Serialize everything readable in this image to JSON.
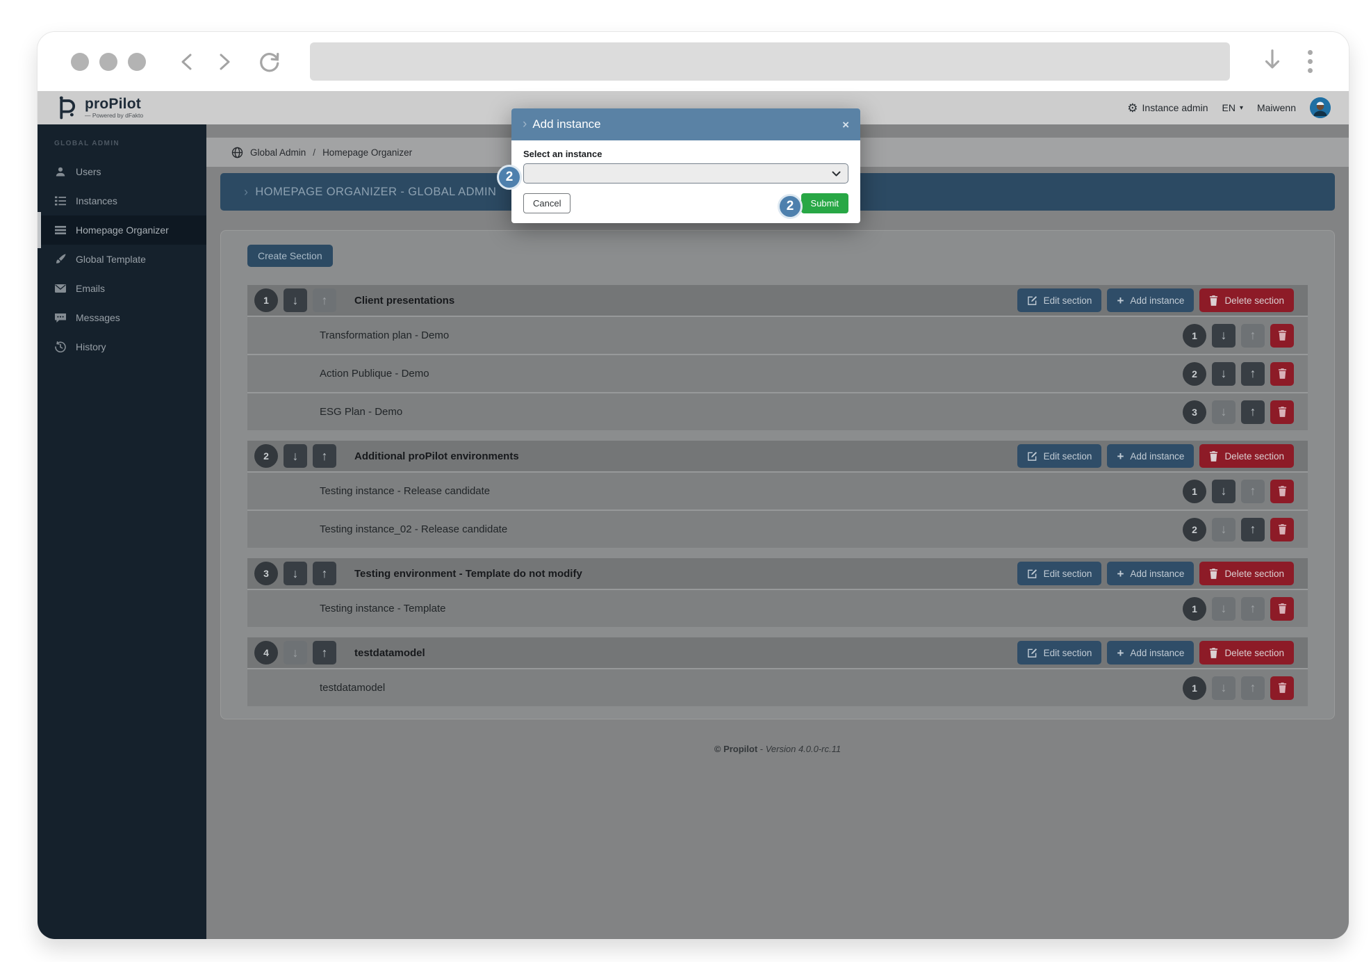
{
  "browser": {
    "url_value": ""
  },
  "header": {
    "brand": "proPilot",
    "tagline": "—  Powered by dFakto",
    "menu": {
      "instance_admin": "Instance admin",
      "language": "EN",
      "user_name": "Maiwenn"
    }
  },
  "sidebar": {
    "group_label": "GLOBAL ADMIN",
    "items": [
      {
        "label": "Users"
      },
      {
        "label": "Instances"
      },
      {
        "label": "Homepage Organizer"
      },
      {
        "label": "Global Template"
      },
      {
        "label": "Emails"
      },
      {
        "label": "Messages"
      },
      {
        "label": "History"
      }
    ]
  },
  "breadcrumb": {
    "items": [
      "Global Admin",
      "Homepage Organizer"
    ],
    "separator": "/"
  },
  "page": {
    "banner_title": "HOMEPAGE ORGANIZER - GLOBAL ADMIN",
    "create_section_label": "Create Section"
  },
  "section_buttons": {
    "edit": "Edit section",
    "add": "Add instance",
    "delete": "Delete section"
  },
  "sections": [
    {
      "num": "1",
      "title": "Client presentations",
      "can_move_down": true,
      "can_move_up": false,
      "rows": [
        {
          "num": "1",
          "name": "Transformation plan - Demo",
          "can_move_down": true,
          "can_move_up": false
        },
        {
          "num": "2",
          "name": "Action Publique - Demo",
          "can_move_down": true,
          "can_move_up": true
        },
        {
          "num": "3",
          "name": "ESG Plan - Demo",
          "can_move_down": false,
          "can_move_up": true
        }
      ]
    },
    {
      "num": "2",
      "title": "Additional proPilot environments",
      "can_move_down": true,
      "can_move_up": true,
      "rows": [
        {
          "num": "1",
          "name": "Testing instance - Release candidate",
          "can_move_down": true,
          "can_move_up": false
        },
        {
          "num": "2",
          "name": "Testing instance_02 - Release candidate",
          "can_move_down": false,
          "can_move_up": true
        }
      ]
    },
    {
      "num": "3",
      "title": "Testing environment - Template do not modify",
      "can_move_down": true,
      "can_move_up": true,
      "rows": [
        {
          "num": "1",
          "name": "Testing instance - Template",
          "can_move_down": false,
          "can_move_up": false
        }
      ]
    },
    {
      "num": "4",
      "title": "testdatamodel",
      "can_move_down": false,
      "can_move_up": true,
      "rows": [
        {
          "num": "1",
          "name": "testdatamodel",
          "can_move_down": false,
          "can_move_up": false
        }
      ]
    }
  ],
  "modal": {
    "title": "Add instance",
    "select_label": "Select an instance",
    "select_value": "",
    "cancel_label": "Cancel",
    "submit_label": "Submit"
  },
  "annotations": [
    {
      "label": "2"
    },
    {
      "label": "2"
    }
  ],
  "footer": {
    "brand": "© Propilot",
    "separator": " - ",
    "version": "Version 4.0.0-rc.11"
  },
  "icons": {
    "arrow_down": "↓",
    "arrow_up": "↑",
    "plus": "+",
    "close": "×",
    "gear": "⚙",
    "caret_down": "▾",
    "chevron": "›"
  },
  "colors": {
    "steel_blue": "#2f4d68",
    "banner_blue": "#2c4a63",
    "danger_red": "#8d1b27",
    "modal_header_blue": "#5a82a5",
    "submit_green": "#28a745",
    "sidebar_navy": "#15212c",
    "annotation_blue": "#4e80ad"
  }
}
